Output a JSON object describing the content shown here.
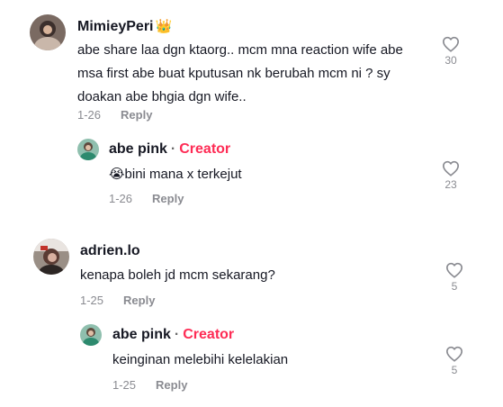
{
  "comments": [
    {
      "username": "MimieyPeri",
      "badge_icon": "crown-emoji",
      "text_lines": [
        "abe share laa dgn ktaorg.. mcm mna reaction wife abe",
        "msa first abe buat kputusan nk berubah mcm ni ? sy",
        "doakan abe bhgia dgn wife.."
      ],
      "date": "1-26",
      "reply_label": "Reply",
      "likes": "30"
    },
    {
      "username": "abe pink",
      "separator": "·",
      "role": "Creator",
      "emoji": "😭",
      "text": "bini mana x terkejut",
      "date": "1-26",
      "reply_label": "Reply",
      "likes": "23"
    },
    {
      "username": "adrien.lo",
      "text": "kenapa boleh jd mcm sekarang?",
      "date": "1-25",
      "reply_label": "Reply",
      "likes": "5"
    },
    {
      "username": "abe pink",
      "separator": "·",
      "role": "Creator",
      "text": "keinginan melebihi kelelakian",
      "date": "1-25",
      "reply_label": "Reply",
      "likes": "5"
    }
  ],
  "colors": {
    "creator_accent": "#fe2c55",
    "meta_gray": "#8a8b91",
    "text": "#161823"
  }
}
